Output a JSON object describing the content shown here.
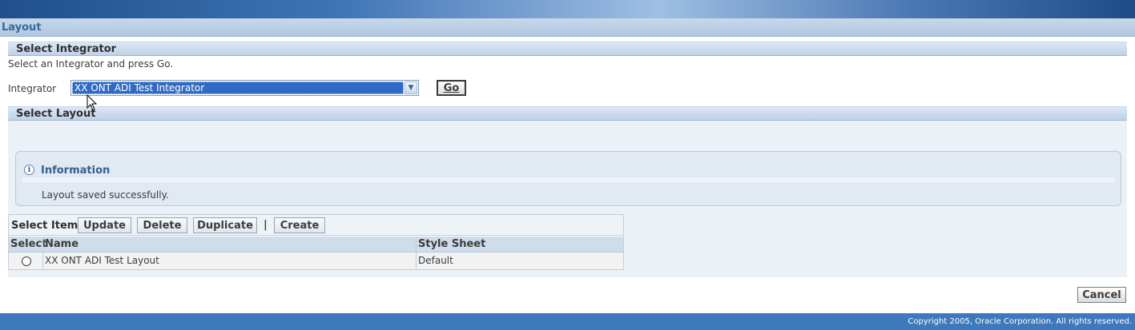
{
  "page": {
    "title": "Layout"
  },
  "select_integrator": {
    "section_title": "Select Integrator",
    "instruction": "Select an Integrator and press Go.",
    "integrator_label": "Integrator",
    "integrator_value": "XX ONT ADI Test Integrator",
    "go_button": "Go",
    "dropdown_icon": "chevron-down-icon"
  },
  "select_layout": {
    "section_title": "Select Layout",
    "info": {
      "icon": "info-icon",
      "title": "Information",
      "message": "Layout saved successfully."
    },
    "toolbar": {
      "select_item_label": "Select Item",
      "update": "Update",
      "delete": "Delete",
      "duplicate": "Duplicate",
      "separator": "|",
      "create": "Create"
    },
    "table": {
      "columns": [
        "Select",
        "Name",
        "Style Sheet"
      ],
      "rows": [
        {
          "name": "XX ONT ADI Test Layout",
          "style_sheet": "Default",
          "selected": false
        }
      ]
    }
  },
  "cancel_button": "Cancel",
  "footer": {
    "copyright": "Copyright 2005, Oracle Corporation. All rights reserved."
  },
  "colors": {
    "brand_blue": "#3e78bd",
    "selection": "#316ac5",
    "section_header": "#bfd2e8"
  }
}
